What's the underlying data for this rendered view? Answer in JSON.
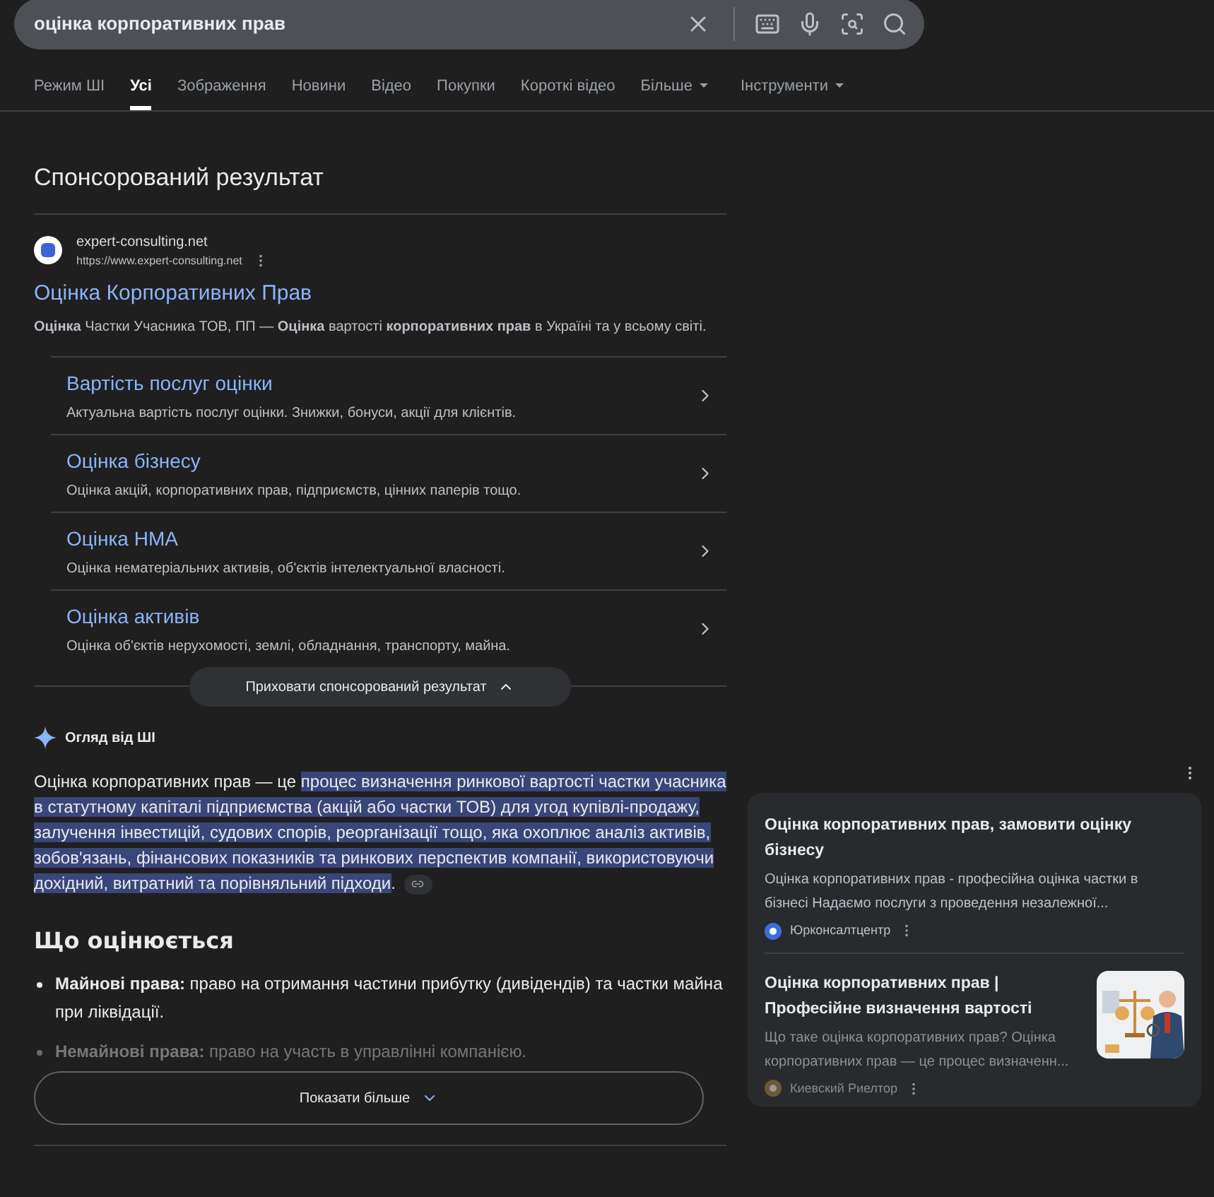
{
  "search": {
    "value": "оцінка корпоративних прав"
  },
  "tabs": [
    {
      "label": "Режим ШІ",
      "selected": false,
      "dropdown": false
    },
    {
      "label": "Усі",
      "selected": true,
      "dropdown": false
    },
    {
      "label": "Зображення",
      "selected": false,
      "dropdown": false
    },
    {
      "label": "Новини",
      "selected": false,
      "dropdown": false
    },
    {
      "label": "Відео",
      "selected": false,
      "dropdown": false
    },
    {
      "label": "Покупки",
      "selected": false,
      "dropdown": false
    },
    {
      "label": "Короткі відео",
      "selected": false,
      "dropdown": false
    },
    {
      "label": "Більше",
      "selected": false,
      "dropdown": true
    },
    {
      "label": "Інструменти",
      "selected": false,
      "dropdown": true
    }
  ],
  "sponsored": {
    "heading": "Спонсорований результат",
    "site_name": "expert-consulting.net",
    "site_url": "https://www.expert-consulting.net",
    "title": "Оцінка Корпоративних Прав",
    "snippet": "**Оцінка** Частки Учасника ТОВ, ПП — **Оцінка** вартості **корпоративних прав** в Україні та у всьому світі.",
    "sitelinks": [
      {
        "title": "Вартість послуг оцінки",
        "description": "Актуальна вартість послуг оцінки. Знижки, бонуси, акції для клієнтів."
      },
      {
        "title": "Оцінка бізнесу",
        "description": "Оцінка акцій, корпоративних прав, підприємств, цінних паперів тощо."
      },
      {
        "title": "Оцінка НМА",
        "description": "Оцінка нематеріальних активів, об'єктів інтелектуальної власності."
      },
      {
        "title": "Оцінка активів",
        "description": "Оцінка об'єктів нерухомості, землі, обладнання, транспорту, майна."
      }
    ],
    "hide_button": "Приховати спонсорований результат"
  },
  "ai_overview": {
    "label": "Огляд від ШІ",
    "lead": "Оцінка корпоративних прав — це ",
    "highlighted": "процес визначення ринкової вартості частки учасника в статутному капіталі підприємства (акцій або частки ТОВ) для угод купівлі-продажу, залучення інвестицій, судових спорів, реорганізації тощо, яка охоплює аналіз активів, зобов'язань, фінансових показників та ринкових перспектив компанії, використовуючи дохідний, витратний та порівняльний підходи",
    "tail": ".",
    "section_heading": "Що оцінюється",
    "bullets": [
      {
        "term": "Майнові права:",
        "text": " право на отримання частини прибутку (дивідендів) та частки майна при ліквідації.",
        "faded": false
      },
      {
        "term": "Немайнові права:",
        "text": " право на участь в управлінні компанією.",
        "faded": true
      }
    ],
    "show_more": "Показати більше"
  },
  "sources": [
    {
      "title": "Оцінка корпоративних прав, замовити оцінку бізнесу",
      "snippet": "Оцінка корпоративних прав - професійна оцінка частки в бізнесі Надаємо послуги з проведення незалежної...",
      "source": "Юрконсалтцентр",
      "thumbnail": false,
      "source_faded": false
    },
    {
      "title": "Оцінка корпоративних прав | Професійне визначення вартості",
      "snippet": "Що таке оцінка корпоративних прав? Оцінка корпоративних прав — це процес визначенн...",
      "source": "Киевский Риелтор",
      "thumbnail": true,
      "source_faded": true
    }
  ]
}
